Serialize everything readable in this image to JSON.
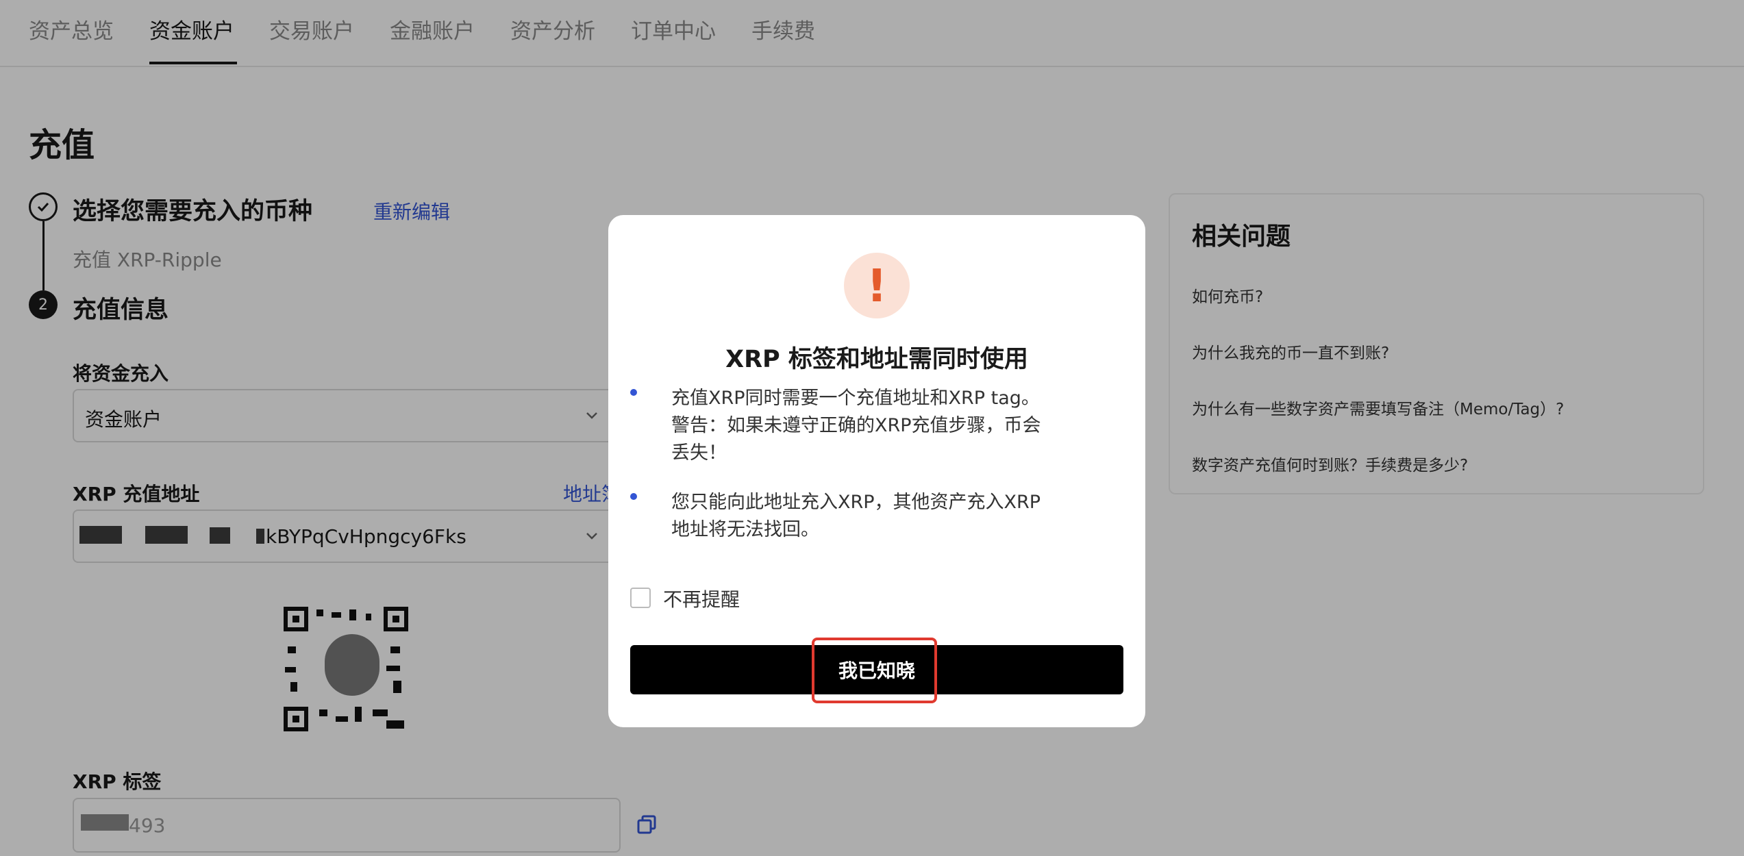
{
  "tabs": [
    {
      "label": "资产总览"
    },
    {
      "label": "资金账户"
    },
    {
      "label": "交易账户"
    },
    {
      "label": "金融账户"
    },
    {
      "label": "资产分析"
    },
    {
      "label": "订单中心"
    },
    {
      "label": "手续费"
    }
  ],
  "page": {
    "title": "充值"
  },
  "step1": {
    "title": "选择您需要充入的币种",
    "edit_link": "重新编辑",
    "subtitle": "充值 XRP-Ripple"
  },
  "step2": {
    "number": "2",
    "title": "充值信息"
  },
  "fund_into": {
    "label": "将资金充入",
    "value": "资金账户"
  },
  "address": {
    "label": "XRP 充值地址",
    "link": "地址簿",
    "value_visible": "kBYPqCvHpngcy6Fks"
  },
  "tag": {
    "label": "XRP 标签",
    "value_visible": "493"
  },
  "faq": {
    "title": "相关问题",
    "items": [
      {
        "text": "如何充币?"
      },
      {
        "text": "为什么我充的币一直不到账?"
      },
      {
        "text": "为什么有一些数字资产需要填写备注（Memo/Tag）?"
      },
      {
        "text": "数字资产充值何时到账？手续费是多少?"
      }
    ]
  },
  "modal": {
    "icon": "exclamation-icon",
    "icon_glyph": "!",
    "title": "XRP 标签和地址需同时使用",
    "bullets": [
      {
        "text": "充值XRP同时需要一个充值地址和XRP tag。警告：如果未遵守正确的XRP充值步骤，币会丢失！"
      },
      {
        "text": "您只能向此地址充入XRP，其他资产充入XRP地址将无法找回。"
      }
    ],
    "checkbox_label": "不再提醒",
    "confirm_label": "我已知晓"
  },
  "colors": {
    "accent": "#3355d4",
    "warning": "#e45b2c",
    "highlight": "#e03a2f"
  }
}
